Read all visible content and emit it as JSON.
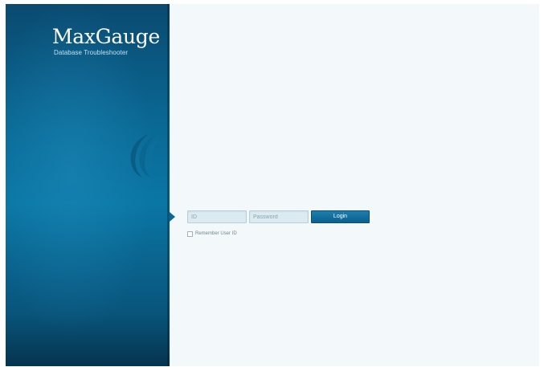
{
  "brand": {
    "logo_text": "MaxGauge",
    "tagline": "Database Troubleshooter",
    "emblem_icon": "swoosh-emblem-icon"
  },
  "login": {
    "id_placeholder": "ID",
    "password_placeholder": "Password",
    "login_label": "Login",
    "remember_label": "Remember User ID",
    "remember_checked": false
  },
  "colors": {
    "panel": "#0a6a96",
    "panel_dark": "#06344f",
    "background": "#f3f8fb",
    "button": "#0b5f8c"
  }
}
